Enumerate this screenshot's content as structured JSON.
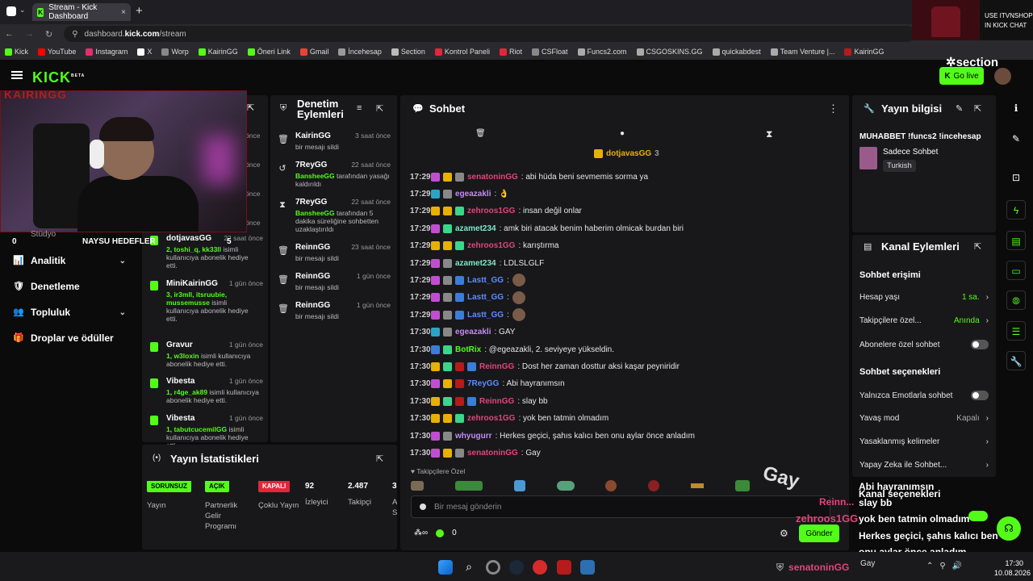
{
  "browser": {
    "tab_title": "Stream - Kick Dashboard",
    "url_prefix": "dashboard.",
    "url_domain": "kick.com",
    "url_path": "/stream",
    "bookmarks": [
      "Kick",
      "YouTube",
      "Instagram",
      "X",
      "Worp",
      "KairinGG",
      "Öneri Link",
      "Gmail",
      "İncehesap",
      "Section",
      "Kontrol Paneli",
      "Riot",
      "CSFloat",
      "Funcs2.com",
      "CSGOSKINS.GG",
      "quickabdest",
      "Team Venture |...",
      "KairinGG"
    ]
  },
  "ad": {
    "line1": "USE ITVNSHOP",
    "line2": "IN KICK CHAT"
  },
  "topnav": {
    "logo": "KICK",
    "beta": "BETA",
    "golive": "Go live",
    "sponsor": "section"
  },
  "overlay": {
    "cam_name": "KAIRINGG",
    "goal_label": "NAYSU HEDEFLER",
    "goal_count": "5",
    "stat_left": "0",
    "stat_left_label": "Stüdyo"
  },
  "leftnav": [
    {
      "label": "Analitik",
      "chev": "⌄"
    },
    {
      "label": "Denetleme",
      "chev": ""
    },
    {
      "label": "Topluluk",
      "chev": "⌄"
    },
    {
      "label": "Droplar ve ödüller",
      "chev": ""
    }
  ],
  "gifts": {
    "times_top": [
      "önce",
      "önce",
      "önce",
      "önce"
    ],
    "items": [
      {
        "name": "dotjavasGG",
        "time": "22 saat önce",
        "hl": "2, toshi_q, kk33ll",
        "desc": " isimli kullanıcıya abonelik hediye etti."
      },
      {
        "name": "MiniKairinGG",
        "time": "1 gün önce",
        "hl": "3, ir3mll, itsruubie, mussemusse",
        "desc": " isimli kullanıcıya abonelik hediye etti."
      },
      {
        "name": "Gravur",
        "time": "1 gün önce",
        "hl": "1, w3loxin",
        "desc": " isimli kullanıcıya abonelik hediye etti."
      },
      {
        "name": "Vibesta",
        "time": "1 gün önce",
        "hl": "1, r4ge_ak89",
        "desc": " isimli kullanıcıya abonelik hediye etti."
      },
      {
        "name": "Vibesta",
        "time": "1 gün önce",
        "hl": "1, tabutcucemilGG",
        "desc": " isimli kullanıcıya abonelik hediye etti."
      }
    ]
  },
  "modpanel": {
    "title1": "Denetim",
    "title2": "Eylemleri",
    "items": [
      {
        "icon": "🗑",
        "name": "KairinGG",
        "time": "3 saat önce",
        "hl": "",
        "desc": "bir mesajı sildi"
      },
      {
        "icon": "↺",
        "name": "7ReyGG",
        "time": "22 saat önce",
        "hl": "BansheeGG",
        "desc": " tarafından yasağı kaldırıldı"
      },
      {
        "icon": "⧗",
        "name": "7ReyGG",
        "time": "22 saat önce",
        "hl": "BansheeGG",
        "desc": " tarafından 5 dakika süreliğine sohbetten uzaklaştırıldı"
      },
      {
        "icon": "🗑",
        "name": "ReinnGG",
        "time": "23 saat önce",
        "hl": "",
        "desc": "bir mesajı sildi"
      },
      {
        "icon": "🗑",
        "name": "ReinnGG",
        "time": "1 gün önce",
        "hl": "",
        "desc": "bir mesajı sildi"
      },
      {
        "icon": "🗑",
        "name": "ReinnGG",
        "time": "1 gün önce",
        "hl": "",
        "desc": "bir mesajı sildi"
      }
    ]
  },
  "chat": {
    "title": "Sohbet",
    "pinned_user": "dotjavasGG",
    "pinned_count": "3",
    "messages": [
      {
        "time": "17:29",
        "badges": [
          "#c04fd0",
          "#e7b100",
          "#888"
        ],
        "user": "senatoninGG",
        "color": "#e0457b",
        "text": ": abi hüda beni sevmemis sorma ya"
      },
      {
        "time": "17:29",
        "badges": [
          "#2aa5c8",
          "#888"
        ],
        "user": "egeazakli",
        "color": "#c38cf2",
        "text": ": 👌"
      },
      {
        "time": "17:29",
        "badges": [
          "#e7b100",
          "#e7b100",
          "#3bd68a"
        ],
        "user": "zehroos1GG",
        "color": "#e0457b",
        "text": ": insan değil onlar"
      },
      {
        "time": "17:29",
        "badges": [
          "#c04fd0",
          "#3bd68a"
        ],
        "user": "azamet234",
        "color": "#7ee8c8",
        "text": ": amk biri atacak benim haberim olmicak burdan biri"
      },
      {
        "time": "17:29",
        "badges": [
          "#e7b100",
          "#e7b100",
          "#3bd68a"
        ],
        "user": "zehroos1GG",
        "color": "#e0457b",
        "text": ": karıştırma"
      },
      {
        "time": "17:29",
        "badges": [
          "#c04fd0",
          "#888"
        ],
        "user": "azamet234",
        "color": "#7ee8c8",
        "text": ": LDLSLGLF"
      },
      {
        "time": "17:29",
        "badges": [
          "#c04fd0",
          "#888",
          "#3b7dd8"
        ],
        "user": "Lastt_GG",
        "color": "#5b8cff",
        "text": ":"
      },
      {
        "time": "17:29",
        "badges": [
          "#c04fd0",
          "#888",
          "#3b7dd8"
        ],
        "user": "Lastt_GG",
        "color": "#5b8cff",
        "text": ":"
      },
      {
        "time": "17:29",
        "badges": [
          "#c04fd0",
          "#888",
          "#3b7dd8"
        ],
        "user": "Lastt_GG",
        "color": "#5b8cff",
        "text": ":"
      },
      {
        "time": "17:30",
        "badges": [
          "#2aa5c8",
          "#888"
        ],
        "user": "egeazakli",
        "color": "#c38cf2",
        "text": ": GAY"
      },
      {
        "time": "17:30",
        "badges": [
          "#3b7dd8",
          "#3bd68a"
        ],
        "user": "BotRix",
        "color": "#53fc18",
        "text": ": @egeazakli, 2. seviyeye yükseldin."
      },
      {
        "time": "17:30",
        "badges": [
          "#e7b100",
          "#3bd68a",
          "#b51b1b",
          "#3b7dd8"
        ],
        "user": "ReinnGG",
        "color": "#e0457b",
        "text": ": Dost her zaman dosttur aksi kaşar peyniridir"
      },
      {
        "time": "17:30",
        "badges": [
          "#c04fd0",
          "#e7b100",
          "#b51b1b"
        ],
        "user": "7ReyGG",
        "color": "#5b8cff",
        "text": ": Abi hayranımsın"
      },
      {
        "time": "17:30",
        "badges": [
          "#e7b100",
          "#3bd68a",
          "#b51b1b",
          "#3b7dd8"
        ],
        "user": "ReinnGG",
        "color": "#e0457b",
        "text": ": slay bb"
      },
      {
        "time": "17:30",
        "badges": [
          "#e7b100",
          "#e7b100",
          "#3bd68a"
        ],
        "user": "zehroos1GG",
        "color": "#e0457b",
        "text": ": yok ben tatmin olmadım"
      },
      {
        "time": "17:30",
        "badges": [
          "#c04fd0",
          "#888"
        ],
        "user": "whyugurr",
        "color": "#c38cf2",
        "text": ": Herkes geçici, şahıs kalıcı ben onu aylar önce anladım"
      },
      {
        "time": "17:30",
        "badges": [
          "#c04fd0",
          "#e7b100",
          "#888"
        ],
        "user": "senatoninGG",
        "color": "#e0457b",
        "text": ": Gay"
      }
    ],
    "followers_only": "Takipçilere Özel",
    "input_placeholder": "Bir mesaj gönderin",
    "send": "Gönder",
    "zero": "0"
  },
  "streaminfo": {
    "title": "Yayın bilgisi",
    "stream_title": "MUHABBET !funcs2 !incehesap",
    "category": "Sadece Sohbet",
    "language": "Turkish"
  },
  "channelactions": {
    "title": "Kanal Eylemleri",
    "access_heading": "Sohbet erişimi",
    "rows1": [
      {
        "label": "Hesap yaşı",
        "value": "1 sa.",
        "kind": "value"
      },
      {
        "label": "Takipçilere özel...",
        "value": "Anında",
        "kind": "value"
      },
      {
        "label": "Abonelere özel sohbet",
        "value": "",
        "kind": "toggle"
      }
    ],
    "options_heading": "Sohbet seçenekleri",
    "rows2": [
      {
        "label": "Yalnızca Emotlarla sohbet",
        "value": "",
        "kind": "toggle"
      },
      {
        "label": "Yavaş mod",
        "value": "Kapalı",
        "kind": "grey"
      },
      {
        "label": "Yasaklanmış kelimeler",
        "value": "",
        "kind": "grey"
      },
      {
        "label": "Yapay Zeka ile Sohbet...",
        "value": "",
        "kind": "grey"
      }
    ]
  },
  "stats": {
    "title": "Yayın İstatistikleri",
    "cols": [
      {
        "badge": "SORUNSUZ",
        "badge_color": "#53fc18",
        "label": "Yayın"
      },
      {
        "badge": "AÇIK",
        "badge_color": "#53fc18",
        "label": "Partnerlik Gelir Programı"
      },
      {
        "badge": "KAPALI",
        "badge_color": "#e4263a",
        "label": "Çoklu Yayın"
      },
      {
        "badge": "92",
        "badge_color": "",
        "label": "İzleyici"
      },
      {
        "badge": "2.487",
        "badge_color": "",
        "label": "Takipçi"
      },
      {
        "badge": "3",
        "badge_color": "",
        "label": "A S"
      }
    ]
  },
  "overlay_chat": {
    "lines": [
      "Abi hayranımsın",
      "Kanal seçenekleri",
      "slay bb",
      "yok ben tatmin olmadım",
      "Herkes geçici, şahıs kalıcı ben",
      "onu aylar önce anladım"
    ],
    "user1": "Reinn...",
    "user2": "zehroos1GG",
    "user3": "senatoninGG",
    "gay": "Gay"
  },
  "taskbar": {
    "time": "17:30",
    "date": "10.08.2026"
  }
}
